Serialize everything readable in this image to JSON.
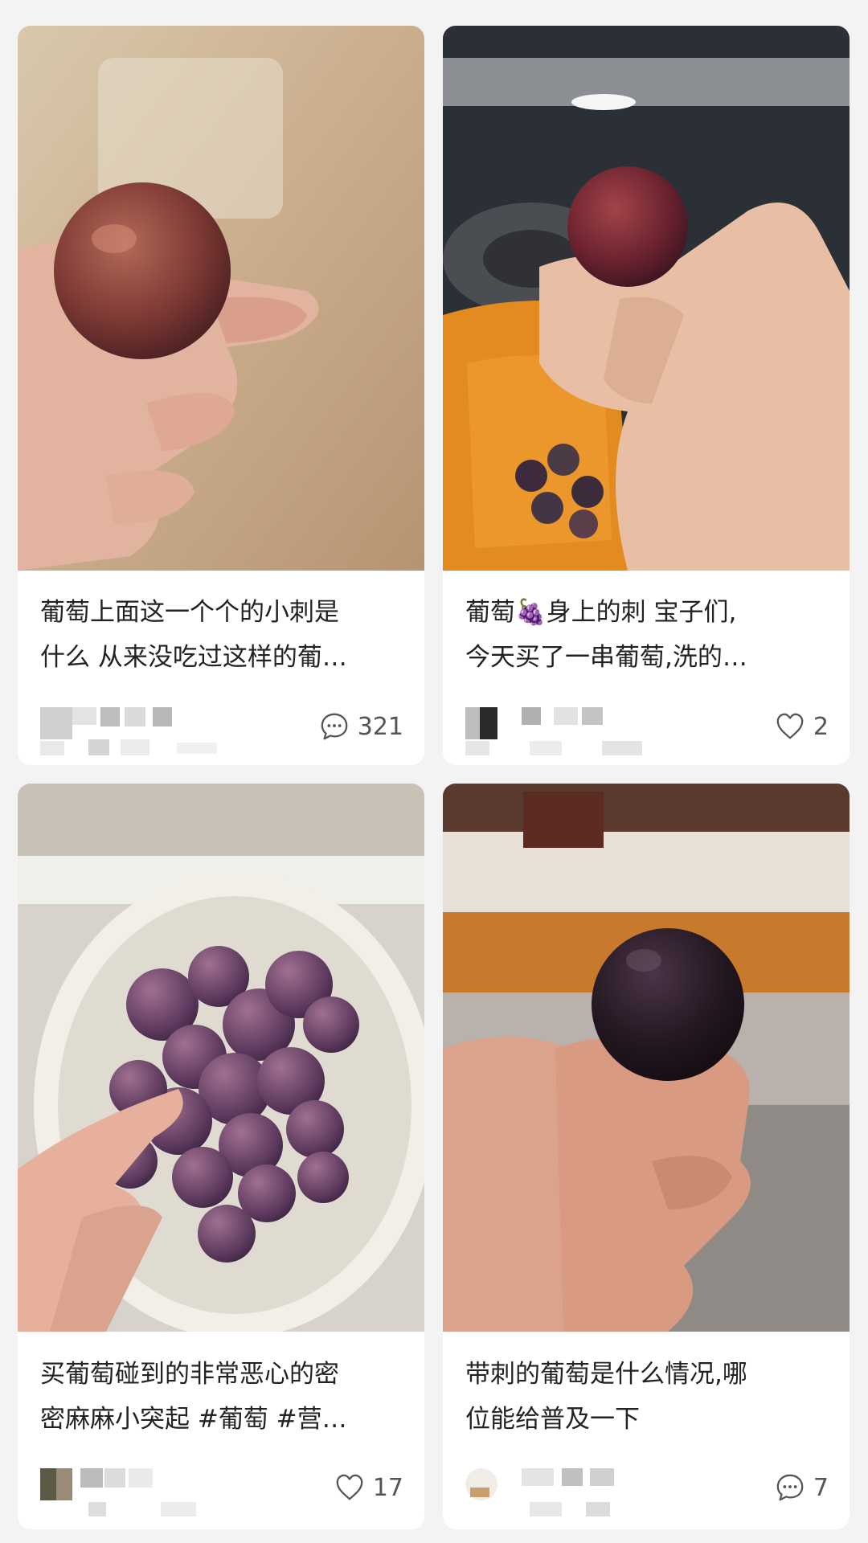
{
  "cards": [
    {
      "title_line1": "葡萄上面这一个个的小刺是",
      "title_line2": "什么 从来没吃过这样的葡…",
      "stat_icon": "comment-icon",
      "stat_value": "321"
    },
    {
      "title_line1a": "葡萄",
      "title_emoji": "🍇",
      "title_line1b": "身上的刺 宝子们,",
      "title_line2": "今天买了一串葡萄,洗的…",
      "stat_icon": "heart-icon",
      "stat_value": "2"
    },
    {
      "title_line1": "买葡萄碰到的非常恶心的密",
      "title_line2": "密麻麻小突起 #葡萄  #营…",
      "stat_icon": "heart-icon",
      "stat_value": "17"
    },
    {
      "title_line1": "带刺的葡萄是什么情况,哪",
      "title_line2": "位能给普及一下",
      "stat_icon": "comment-icon",
      "stat_value": "7"
    }
  ],
  "colors": {
    "background": "#f3f3f3",
    "card": "#ffffff",
    "text": "#222222",
    "stat_text": "#555555"
  }
}
